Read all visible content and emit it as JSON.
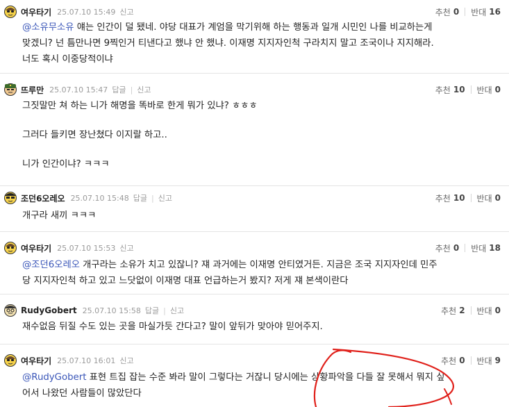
{
  "labels": {
    "recommend": "추천",
    "oppose": "반대",
    "reply": "답글",
    "report": "신고"
  },
  "comments": [
    {
      "nick": "여우타기",
      "date": "25.07.10 15:49",
      "recommend": "0",
      "oppose": "16",
      "mention": "@소유무소유",
      "lines": [
        "얘는 인간이 덜 됐네. 야당 대표가 계엄을 막기위해 하는 행동과 일개 시민인 나를 비교하는게",
        "맞겠니? 넌 틈만나면 9찍인거 티낸다고 했냐 안 했냐. 이재명 지지자인척 구라치지 말고 조국이나 지지해라.",
        "너도 혹시 이중당적이냐"
      ]
    },
    {
      "nick": "뜨루만",
      "date": "25.07.10 15:47",
      "recommend": "10",
      "oppose": "0",
      "lines": [
        "그짓말만 쳐 하는 니가 해명을 똑바로 한게 뭐가 있냐? ㅎㅎㅎ",
        "그러다 들키면 장난쳤다 이지랄 하고..",
        "니가 인간이냐? ㅋㅋㅋ"
      ]
    },
    {
      "nick": "조던6오레오",
      "date": "25.07.10 15:48",
      "recommend": "10",
      "oppose": "0",
      "lines": [
        "개구라 새끼 ㅋㅋㅋ"
      ]
    },
    {
      "nick": "여우타기",
      "date": "25.07.10 15:53",
      "recommend": "0",
      "oppose": "18",
      "mention": "@조던6오레오",
      "lines": [
        "개구라는 소유가 치고 있잖니? 쟤 과거에는 이재명 안티였거든. 지금은 조국 지지자인데 민주",
        "당 지지자인척 하고 있고 느닷없이 이재명 대표 언급하는거 봤지? 저게 쟤 본색이란다"
      ]
    },
    {
      "nick": "RudyGobert",
      "date": "25.07.10 15:58",
      "recommend": "2",
      "oppose": "0",
      "lines": [
        "재수없음 뒤질 수도 있는 곳을 마실가듯 간다고? 말이 앞뒤가 맞아야 믿어주지."
      ]
    },
    {
      "nick": "여우타기",
      "date": "25.07.10 16:01",
      "recommend": "0",
      "oppose": "9",
      "mention": "@RudyGobert",
      "lines": [
        "표현 트집 잡는 수준 봐라 말이 그렇다는 거잖니 당시에는 상황파악을 다들 잘 못해서 뭐지 싶",
        "어서 나왔던 사람들이 많았단다"
      ]
    }
  ]
}
